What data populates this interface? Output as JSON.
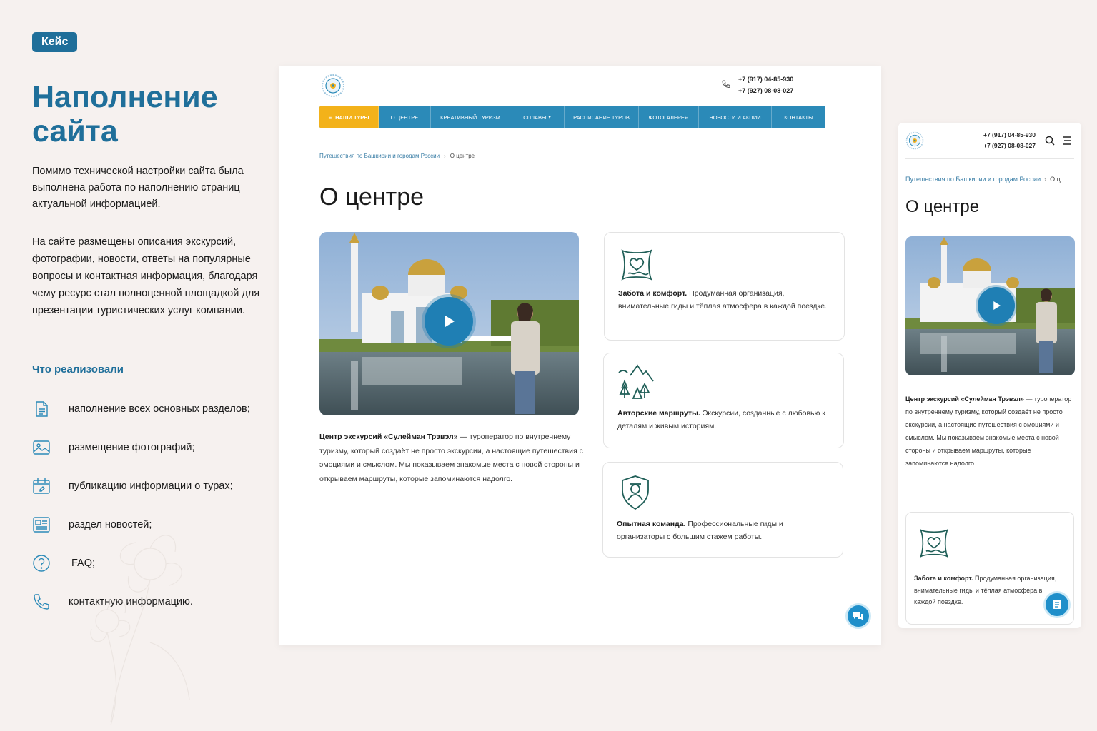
{
  "colors": {
    "brand": "#1f6f9a",
    "nav": "#2b8ab8",
    "nav_active": "#f3b21a",
    "icon_green": "#1f5e57",
    "background": "#f6f1ef"
  },
  "left": {
    "badge": "Кейс",
    "title": "Наполнение сайта",
    "intro": "Помимо технической настройки сайта была выполнена работа по наполнению страниц актуальной информацией.",
    "intro2": "На сайте размещены описания экскурсий, фотографии, новости, ответы на популярные вопросы и контактная информация, благодаря чему ресурс стал полноценной площадкой для презентации туристических услуг компании.",
    "implemented_title": "Что реализовали",
    "features": [
      {
        "icon": "document-icon",
        "label": "наполнение всех основных разделов;"
      },
      {
        "icon": "image-icon",
        "label": "размещение фотографий;"
      },
      {
        "icon": "calendar-icon",
        "label": "публикацию информации о турах;"
      },
      {
        "icon": "news-icon",
        "label": "раздел новостей;"
      },
      {
        "icon": "question-icon",
        "label": "FAQ;"
      },
      {
        "icon": "phone-icon",
        "label": "контактную информацию."
      }
    ]
  },
  "desktop": {
    "phones": [
      "+7 (917) 04-85-930",
      "+7 (927) 08-08-027"
    ],
    "nav": [
      "НАШИ ТУРЫ",
      "О ЦЕНТРЕ",
      "КРЕАТИВНЫЙ ТУРИЗМ",
      "СПЛАВЫ",
      "РАСПИСАНИЕ ТУРОВ",
      "ФОТОГАЛЕРЕЯ",
      "НОВОСТИ И АКЦИИ",
      "КОНТАКТЫ"
    ],
    "breadcrumb": {
      "parent": "Путешествия по Башкирии и городам России",
      "separator": "›",
      "current": "О центре"
    },
    "heading": "О центре",
    "description_bold": "Центр экскурсий «Сулейман Трэвэл»",
    "description": " — туроператор по внутреннему туризму, который создаёт не просто экскурсии, а настоящие путешествия с эмоциями и смыслом. Мы показываем знакомые места с новой стороны и открываем маршруты, которые запоминаются надолго.",
    "cards": [
      {
        "icon": "heart-pillow-icon",
        "title": "Забота и комфорт.",
        "text": " Продуманная организация, внимательные гиды и тёплая атмосфера в каждой поездке."
      },
      {
        "icon": "mountain-trees-icon",
        "title": "Авторские маршруты.",
        "text": " Экскурсии, созданные с любовью к деталям и живым историям."
      },
      {
        "icon": "shield-guide-icon",
        "title": "Опытная команда.",
        "text": " Профессиональные гиды и организаторы с большим стажем работы."
      }
    ]
  },
  "mobile": {
    "phones": [
      "+7 (917) 04-85-930",
      "+7 (927) 08-08-027"
    ],
    "breadcrumb": {
      "parent": "Путешествия по Башкирии и городам России",
      "separator": "›",
      "current": "О ц"
    },
    "heading": "О центре",
    "description_bold": "Центр экскурсий «Сулейман Трэвэл»",
    "description": " — туроператор по внутреннему туризму, который создаёт не просто экскурсии, а настоящие путешествия с эмоциями и смыслом. Мы показываем знакомые места с новой стороны и открываем маршруты, которые запоминаются надолго.",
    "card": {
      "icon": "heart-pillow-icon",
      "title": "Забота и комфорт.",
      "text": " Продуманная организация, внимательные гиды и тёплая атмосфера в каждой поездке."
    }
  }
}
